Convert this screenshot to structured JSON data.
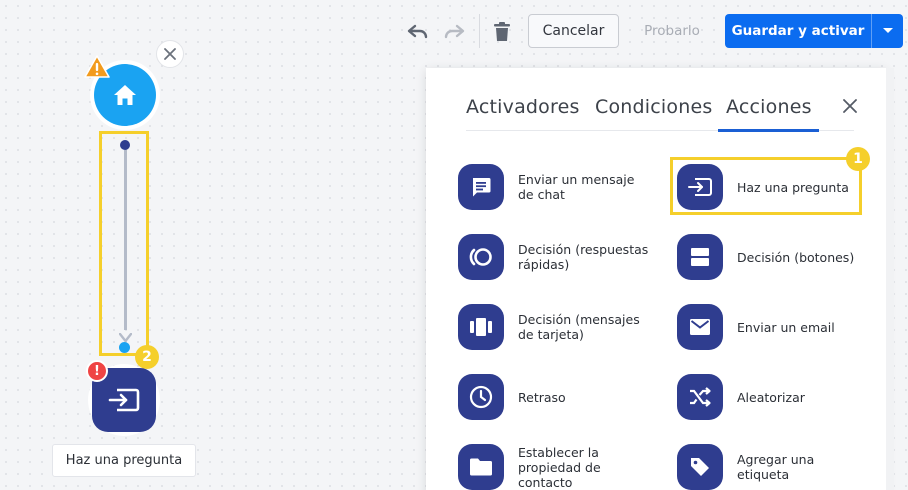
{
  "toolbar": {
    "undo_icon": "undo-icon",
    "redo_icon": "redo-icon",
    "delete_icon": "trash-icon",
    "cancel_label": "Cancelar",
    "test_label": "Probarlo",
    "save_label": "Guardar y activar",
    "save_menu_icon": "chevron-down-icon"
  },
  "flow": {
    "warning_icon": "warning-icon",
    "home_icon": "home-icon",
    "close_icon": "close-icon",
    "error_badge": "!",
    "node_icon": "input-icon",
    "node_label": "Haz una pregunta"
  },
  "callouts": {
    "badge_1": "1",
    "badge_2": "2"
  },
  "panel": {
    "tabs": [
      {
        "label": "Activadores"
      },
      {
        "label": "Condiciones"
      },
      {
        "label": "Acciones",
        "active": true
      }
    ],
    "close_icon": "close-icon",
    "actions": [
      {
        "label": "Enviar un mensaje de chat",
        "icon": "chat-icon"
      },
      {
        "label": "Haz una pregunta",
        "icon": "input-icon"
      },
      {
        "label": "Decisión (respuestas rápidas)",
        "icon": "quick-replies-icon"
      },
      {
        "label": "Decisión (botones)",
        "icon": "buttons-icon"
      },
      {
        "label": "Decisión (mensajes de tarjeta)",
        "icon": "cards-icon"
      },
      {
        "label": "Enviar un email",
        "icon": "mail-icon"
      },
      {
        "label": "Retraso",
        "icon": "clock-icon"
      },
      {
        "label": "Aleatorizar",
        "icon": "shuffle-icon"
      },
      {
        "label": "Establecer la propiedad de contacto",
        "icon": "folder-icon"
      },
      {
        "label": "Agregar una etiqueta",
        "icon": "tag-icon"
      }
    ]
  },
  "colors": {
    "accent": "#0b6cf0",
    "node_dark": "#2f3d8f",
    "node_light": "#1aa3f2",
    "highlight": "#f5cf2b",
    "error": "#ef4444"
  }
}
